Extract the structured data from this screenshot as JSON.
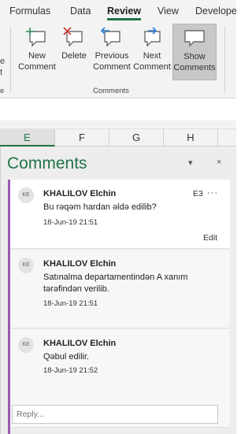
{
  "ribbon": {
    "tabs": [
      "Formulas",
      "Data",
      "Review",
      "View",
      "Develope"
    ],
    "active_tab": "Review",
    "edge_labels": [
      "e",
      "t",
      "e"
    ],
    "buttons": {
      "new": [
        "New",
        "Comment"
      ],
      "delete": "Delete",
      "previous": [
        "Previous",
        "Comment"
      ],
      "next": [
        "Next",
        "Comment"
      ],
      "show": [
        "Show",
        "Comments"
      ]
    },
    "group_label": "Comments"
  },
  "columns": [
    "E",
    "F",
    "G",
    "H"
  ],
  "selected_column": "E",
  "pane": {
    "title": "Comments",
    "dropdown_glyph": "▾",
    "close_glyph": "×"
  },
  "comments": [
    {
      "initials": "KE",
      "author": "KHALILOV Elchin",
      "text": "Bu rəqəm hardan əldə edilib?",
      "time": "18-Jun-19 21:51",
      "cell_ref": "E3",
      "more": "···",
      "edit": "Edit"
    },
    {
      "initials": "KE",
      "author": "KHALILOV Elchin",
      "text": "Satınalma departamentindən A xanım tərəfindən verilib.",
      "time": "18-Jun-19 21:51"
    },
    {
      "initials": "KE",
      "author": "KHALILOV Elchin",
      "text": "Qəbul edilir.",
      "time": "18-Jun-19 21:52"
    }
  ],
  "reply": {
    "placeholder": "Reply..."
  },
  "colors": {
    "accent_green": "#217346",
    "thread_bar": "#9b59b6"
  }
}
